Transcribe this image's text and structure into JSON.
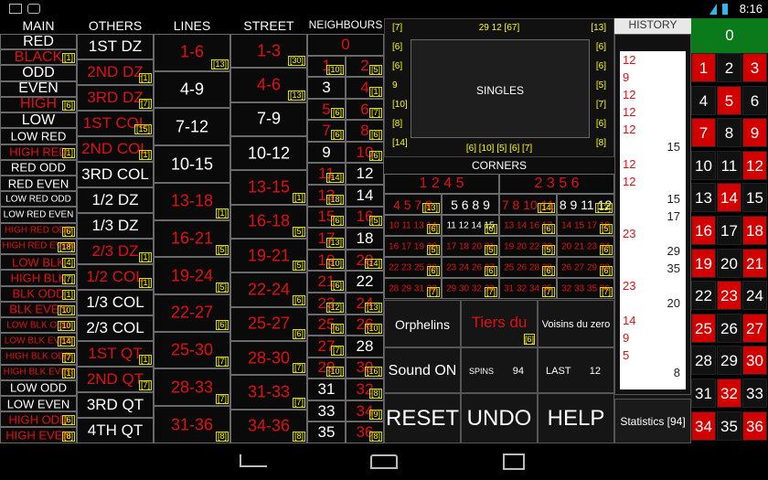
{
  "status": {
    "time": "8:16"
  },
  "headers": {
    "main": "MAIN",
    "others": "OTHERS",
    "lines": "LINES",
    "street": "STREET",
    "neighbours": "NEIGHBOURS",
    "singles": "SINGLES",
    "corners": "CORNERS",
    "history": "HISTORY"
  },
  "main": [
    {
      "t": "RED",
      "c": "w",
      "n": ""
    },
    {
      "t": "BLACK",
      "c": "r",
      "n": "[1]"
    },
    {
      "t": "ODD",
      "c": "w",
      "n": ""
    },
    {
      "t": "EVEN",
      "c": "w",
      "n": ""
    },
    {
      "t": "HIGH",
      "c": "r",
      "n": "[6]"
    },
    {
      "t": "LOW",
      "c": "w",
      "n": ""
    },
    {
      "t": "LOW RED",
      "c": "w",
      "n": ""
    },
    {
      "t": "HIGH RED",
      "c": "r",
      "n": "[1]"
    },
    {
      "t": "RED ODD",
      "c": "w",
      "n": ""
    },
    {
      "t": "RED EVEN",
      "c": "w",
      "n": ""
    },
    {
      "t": "LOW RED ODD",
      "c": "w",
      "n": ""
    },
    {
      "t": "LOW RED EVEN",
      "c": "w",
      "n": ""
    },
    {
      "t": "HIGH RED ODD",
      "c": "r",
      "n": "[6]"
    },
    {
      "t": "HIGH RED EVEN",
      "c": "r",
      "n": "[18]"
    },
    {
      "t": "LOW BLK",
      "c": "r",
      "n": "[4]"
    },
    {
      "t": "HIGH BLK",
      "c": "r",
      "n": "[7]"
    },
    {
      "t": "BLK ODD",
      "c": "r",
      "n": "[1]"
    },
    {
      "t": "BLK EVEN",
      "c": "r",
      "n": "[10]"
    },
    {
      "t": "LOW BLK ODD",
      "c": "r",
      "n": "[10]"
    },
    {
      "t": "LOW BLK EVEN",
      "c": "r",
      "n": "[14]"
    },
    {
      "t": "HIGH BLK ODD",
      "c": "r",
      "n": "[7]"
    },
    {
      "t": "HIGH BLK EVEN",
      "c": "r",
      "n": "[1]"
    },
    {
      "t": "LOW ODD",
      "c": "w",
      "n": ""
    },
    {
      "t": "LOW EVEN",
      "c": "w",
      "n": ""
    },
    {
      "t": "HIGH ODD",
      "c": "r",
      "n": "[6]"
    },
    {
      "t": "HIGH EVEN",
      "c": "r",
      "n": "[8]"
    }
  ],
  "others": [
    {
      "t": "1ST DZ",
      "c": "w",
      "n": ""
    },
    {
      "t": "2ND DZ",
      "c": "r",
      "n": "[1]"
    },
    {
      "t": "3RD DZ",
      "c": "r",
      "n": "[7]"
    },
    {
      "t": "1ST COL",
      "c": "r",
      "n": "[15]"
    },
    {
      "t": "2ND COL",
      "c": "r",
      "n": "[1]"
    },
    {
      "t": "3RD COL",
      "c": "w",
      "n": ""
    },
    {
      "t": "1/2 DZ",
      "c": "w",
      "n": ""
    },
    {
      "t": "1/3 DZ",
      "c": "w",
      "n": ""
    },
    {
      "t": "2/3 DZ",
      "c": "r",
      "n": "[1]"
    },
    {
      "t": "1/2 COL",
      "c": "r",
      "n": "[1]"
    },
    {
      "t": "1/3 COL",
      "c": "w",
      "n": ""
    },
    {
      "t": "2/3 COL",
      "c": "w",
      "n": ""
    },
    {
      "t": "1ST QT",
      "c": "r",
      "n": "[1]"
    },
    {
      "t": "2ND QT",
      "c": "r",
      "n": "[7]"
    },
    {
      "t": "3RD QT",
      "c": "w",
      "n": ""
    },
    {
      "t": "4TH QT",
      "c": "w",
      "n": ""
    }
  ],
  "lines": [
    {
      "t": "1-6",
      "c": "r",
      "n": "[13]"
    },
    {
      "t": "4-9",
      "c": "w",
      "n": ""
    },
    {
      "t": "7-12",
      "c": "w",
      "n": ""
    },
    {
      "t": "10-15",
      "c": "w",
      "n": ""
    },
    {
      "t": "13-18",
      "c": "r",
      "n": "[1]"
    },
    {
      "t": "16-21",
      "c": "r",
      "n": "[5]"
    },
    {
      "t": "19-24",
      "c": "r",
      "n": "[5]"
    },
    {
      "t": "22-27",
      "c": "r",
      "n": "[6]"
    },
    {
      "t": "25-30",
      "c": "r",
      "n": "[7]"
    },
    {
      "t": "28-33",
      "c": "r",
      "n": "[7]"
    },
    {
      "t": "31-36",
      "c": "r",
      "n": "[8]"
    }
  ],
  "street": [
    {
      "t": "1-3",
      "c": "r",
      "n": "[30]"
    },
    {
      "t": "4-6",
      "c": "r",
      "n": "[13]"
    },
    {
      "t": "7-9",
      "c": "w",
      "n": ""
    },
    {
      "t": "10-12",
      "c": "w",
      "n": ""
    },
    {
      "t": "13-15",
      "c": "r",
      "n": "[1]"
    },
    {
      "t": "16-18",
      "c": "r",
      "n": "[5]"
    },
    {
      "t": "19-21",
      "c": "r",
      "n": "[5]"
    },
    {
      "t": "22-24",
      "c": "r",
      "n": "[6]"
    },
    {
      "t": "25-27",
      "c": "r",
      "n": "[6]"
    },
    {
      "t": "28-30",
      "c": "r",
      "n": "[7]"
    },
    {
      "t": "31-33",
      "c": "r",
      "n": "[7]"
    },
    {
      "t": "34-36",
      "c": "r",
      "n": "[8]"
    }
  ],
  "neighbours": [
    [
      {
        "t": "0",
        "c": "r",
        "n": ""
      }
    ],
    [
      {
        "t": "1",
        "c": "r",
        "n": "[10]"
      },
      {
        "t": "2",
        "c": "r",
        "n": "[5]"
      }
    ],
    [
      {
        "t": "3",
        "c": "w",
        "n": ""
      },
      {
        "t": "4",
        "c": "r",
        "n": "[1]"
      }
    ],
    [
      {
        "t": "5",
        "c": "r",
        "n": "[6]"
      },
      {
        "t": "6",
        "c": "r",
        "n": "[7]"
      }
    ],
    [
      {
        "t": "7",
        "c": "r",
        "n": "[6]"
      },
      {
        "t": "8",
        "c": "r",
        "n": "[6]"
      }
    ],
    [
      {
        "t": "9",
        "c": "w",
        "n": ""
      },
      {
        "t": "10",
        "c": "r",
        "n": "[6]"
      }
    ],
    [
      {
        "t": "11",
        "c": "r",
        "n": "[14]"
      },
      {
        "t": "12",
        "c": "w",
        "n": ""
      }
    ],
    [
      {
        "t": "13",
        "c": "r",
        "n": "[18]"
      },
      {
        "t": "14",
        "c": "w",
        "n": ""
      }
    ],
    [
      {
        "t": "15",
        "c": "r",
        "n": "[6]"
      },
      {
        "t": "16",
        "c": "r",
        "n": "[5]"
      }
    ],
    [
      {
        "t": "17",
        "c": "r",
        "n": "[13]"
      },
      {
        "t": "18",
        "c": "w",
        "n": ""
      }
    ],
    [
      {
        "t": "19",
        "c": "r",
        "n": "[10]"
      },
      {
        "t": "20",
        "c": "r",
        "n": "[14]"
      }
    ],
    [
      {
        "t": "21",
        "c": "r",
        "n": "[6]"
      },
      {
        "t": "22",
        "c": "w",
        "n": ""
      }
    ],
    [
      {
        "t": "23",
        "c": "r",
        "n": "[12]"
      },
      {
        "t": "24",
        "c": "r",
        "n": "[13]"
      }
    ],
    [
      {
        "t": "25",
        "c": "r",
        "n": "[6]"
      },
      {
        "t": "26",
        "c": "r",
        "n": "[10]"
      }
    ],
    [
      {
        "t": "27",
        "c": "r",
        "n": "[7]"
      },
      {
        "t": "28",
        "c": "w",
        "n": ""
      }
    ],
    [
      {
        "t": "29",
        "c": "r",
        "n": "[10]"
      },
      {
        "t": "30",
        "c": "r",
        "n": "[16]"
      }
    ],
    [
      {
        "t": "31",
        "c": "w",
        "n": ""
      },
      {
        "t": "32",
        "c": "r",
        "n": "[8]"
      }
    ],
    [
      {
        "t": "33",
        "c": "w",
        "n": ""
      },
      {
        "t": "34",
        "c": "r",
        "n": "[9]"
      }
    ],
    [
      {
        "t": "35",
        "c": "w",
        "n": ""
      },
      {
        "t": "36",
        "c": "r",
        "n": "[8]"
      }
    ]
  ],
  "singles_rows": [
    {
      "l": "[7]",
      "m": "29 12 [67]",
      "r": "[13]"
    },
    {
      "l": "[6]",
      "r": "[6]"
    },
    {
      "l": "[6]",
      "r": "[6]"
    },
    {
      "l": "9",
      "r": "[5]"
    },
    {
      "l": "[10]",
      "r": "[7]"
    },
    {
      "l": "[8]",
      "r": "[6]"
    },
    {
      "l": "[14]",
      "m": "[6] [10] [5] [6] [7]",
      "r": "[8]"
    }
  ],
  "corners_top": [
    {
      "t": "1 2 4 5",
      "c": "r",
      "n": ""
    },
    {
      "t": "2 3 5 6",
      "c": "r",
      "n": ""
    }
  ],
  "corners": [
    [
      {
        "t": "4 5 7 8",
        "c": "r",
        "n": "[13]"
      },
      {
        "t": "5 6 8 9",
        "c": "w",
        "n": ""
      },
      {
        "t": "7 8 10 11",
        "c": "r",
        "n": "[14]"
      },
      {
        "t": "8 9 11 12",
        "c": "w",
        "n": "[13]"
      }
    ],
    [
      {
        "t": "10 11 13 14",
        "c": "r",
        "n": "[6]"
      },
      {
        "t": "11 12 14 15",
        "c": "w",
        "n": "[6]"
      },
      {
        "t": "13 14 16 17",
        "c": "r",
        "n": "[6]"
      },
      {
        "t": "14 15 17 18",
        "c": "r",
        "n": "[5]"
      }
    ],
    [
      {
        "t": "16 17 19 20",
        "c": "r",
        "n": "[5]"
      },
      {
        "t": "17 18 20 21",
        "c": "r",
        "n": "[5]"
      },
      {
        "t": "19 20 22 23",
        "c": "r",
        "n": "[5]"
      },
      {
        "t": "20 21 23 24",
        "c": "r",
        "n": "[6]"
      }
    ],
    [
      {
        "t": "22 23 25 26",
        "c": "r",
        "n": "[6]"
      },
      {
        "t": "23 24 26 27",
        "c": "r",
        "n": "[6]"
      },
      {
        "t": "25 26 28 29",
        "c": "r",
        "n": "[6]"
      },
      {
        "t": "26 27 29 30",
        "c": "r",
        "n": "[6]"
      }
    ],
    [
      {
        "t": "28 29 31 32",
        "c": "r",
        "n": "[7]"
      },
      {
        "t": "29 30 32 33",
        "c": "r",
        "n": "[7]"
      },
      {
        "t": "31 32 34 35",
        "c": "r",
        "n": "[7]"
      },
      {
        "t": "32 33 35 36",
        "c": "r",
        "n": "[7]"
      }
    ]
  ],
  "sectors": {
    "orphelins": "Orphelins",
    "tiers": "Tiers du",
    "tiers_n": "[6]",
    "voisins": "Voisins du zero"
  },
  "sound": "Sound ON",
  "spins_label": "SPINS",
  "spins": "94",
  "last_label": "LAST",
  "last": "12",
  "reset": "RESET",
  "undo": "UNDO",
  "help": "HELP",
  "statistics": "Statistics [94]",
  "history": [
    {
      "v": "12",
      "c": "r",
      "s": "l"
    },
    {
      "v": "9",
      "c": "r",
      "s": "l"
    },
    {
      "v": "12",
      "c": "r",
      "s": "l"
    },
    {
      "v": "12",
      "c": "r",
      "s": "l"
    },
    {
      "v": "12",
      "c": "r",
      "s": "l"
    },
    {
      "v": "15",
      "c": "k",
      "s": "r"
    },
    {
      "v": "12",
      "c": "r",
      "s": "l"
    },
    {
      "v": "12",
      "c": "r",
      "s": "l"
    },
    {
      "v": "15",
      "c": "k",
      "s": "r"
    },
    {
      "v": "17",
      "c": "k",
      "s": "r"
    },
    {
      "v": "23",
      "c": "r",
      "s": "l"
    },
    {
      "v": "29",
      "c": "k",
      "s": "r"
    },
    {
      "v": "35",
      "c": "k",
      "s": "r"
    },
    {
      "v": "23",
      "c": "r",
      "s": "l"
    },
    {
      "v": "20",
      "c": "k",
      "s": "r"
    },
    {
      "v": "14",
      "c": "r",
      "s": "l"
    },
    {
      "v": "9",
      "c": "r",
      "s": "l"
    },
    {
      "v": "5",
      "c": "r",
      "s": "l"
    },
    {
      "v": "8",
      "c": "k",
      "s": "r"
    }
  ],
  "wheel": {
    "zero": "0",
    "rows": [
      [
        "1",
        "2",
        "3"
      ],
      [
        "4",
        "5",
        "6"
      ],
      [
        "7",
        "8",
        "9"
      ],
      [
        "10",
        "11",
        "12"
      ],
      [
        "13",
        "14",
        "15"
      ],
      [
        "16",
        "17",
        "18"
      ],
      [
        "19",
        "20",
        "21"
      ],
      [
        "22",
        "23",
        "24"
      ],
      [
        "25",
        "26",
        "27"
      ],
      [
        "28",
        "29",
        "30"
      ],
      [
        "31",
        "32",
        "33"
      ],
      [
        "34",
        "35",
        "36"
      ]
    ],
    "reds": [
      "1",
      "3",
      "5",
      "7",
      "9",
      "12",
      "14",
      "16",
      "18",
      "19",
      "21",
      "23",
      "25",
      "27",
      "30",
      "32",
      "34",
      "36"
    ]
  }
}
